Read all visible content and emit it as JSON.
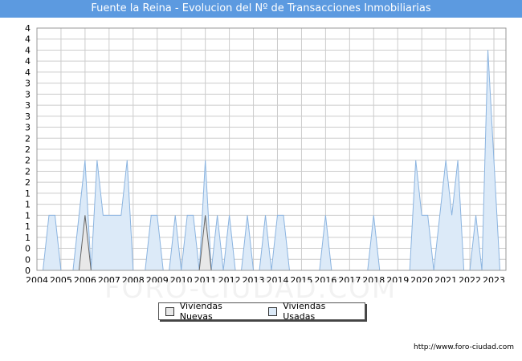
{
  "title": "Fuente la Reina - Evolucion del Nº de Transacciones Inmobiliarias",
  "watermark": "FORO-CIUDAD.COM",
  "footer": "http://www.foro-ciudad.com",
  "legend": {
    "nuevas": "Viviendas Nuevas",
    "usadas": "Viviendas Usadas"
  },
  "colors": {
    "title_bg": "#5c9ae0",
    "usadas_fill": "#dceaf8",
    "usadas_line": "#8bb4e0",
    "nuevas_fill": "#e8e8e8",
    "nuevas_line": "#666666",
    "grid": "#cccccc"
  },
  "chart_data": {
    "type": "area",
    "title": "Fuente la Reina - Evolucion del Nº de Transacciones Inmobiliarias",
    "xlabel": "",
    "ylabel": "",
    "x_ticks": [
      "2004",
      "2005",
      "2006",
      "2007",
      "2008",
      "2009",
      "2010",
      "2011",
      "2012",
      "2013",
      "2014",
      "2015",
      "2016",
      "2017",
      "2018",
      "2019",
      "2020",
      "2021",
      "2022",
      "2023"
    ],
    "y_ticks": [
      "0",
      "0",
      "0",
      "1",
      "1",
      "1",
      "1",
      "1",
      "2",
      "2",
      "2",
      "2",
      "2",
      "3",
      "3",
      "3",
      "3",
      "3",
      "4",
      "4",
      "4",
      "4",
      "4"
    ],
    "xlim": [
      2004,
      2023.5
    ],
    "ylim": [
      0,
      4.4
    ],
    "grid": true,
    "legend_position": "bottom",
    "x": [
      2004.25,
      2004.5,
      2004.75,
      2005,
      2005.25,
      2005.5,
      2005.75,
      2006,
      2006.25,
      2006.5,
      2006.75,
      2007,
      2007.25,
      2007.5,
      2007.75,
      2008,
      2008.25,
      2008.5,
      2008.75,
      2009,
      2009.25,
      2009.5,
      2009.75,
      2010,
      2010.25,
      2010.5,
      2010.75,
      2011,
      2011.25,
      2011.5,
      2011.75,
      2012,
      2012.25,
      2012.5,
      2012.75,
      2013,
      2013.25,
      2013.5,
      2013.75,
      2014,
      2014.25,
      2014.5,
      2014.75,
      2015,
      2015.25,
      2015.5,
      2015.75,
      2016,
      2016.25,
      2016.5,
      2016.75,
      2017,
      2017.25,
      2017.5,
      2017.75,
      2018,
      2018.25,
      2018.5,
      2018.75,
      2019,
      2019.25,
      2019.5,
      2019.75,
      2020,
      2020.25,
      2020.5,
      2020.75,
      2021,
      2021.25,
      2021.5,
      2021.75,
      2022,
      2022.25,
      2022.5,
      2022.75,
      2023,
      2023.25
    ],
    "series": [
      {
        "name": "Viviendas Nuevas",
        "values": [
          0,
          0,
          0,
          0,
          0,
          0,
          0,
          1,
          0,
          0,
          0,
          0,
          0,
          0,
          0,
          0,
          0,
          0,
          0,
          0,
          0,
          0,
          0,
          0,
          0,
          0,
          0,
          1,
          0,
          0,
          0,
          0,
          0,
          0,
          0,
          0,
          0,
          0,
          0,
          0,
          0,
          0,
          0,
          0,
          0,
          0,
          0,
          0,
          0,
          0,
          0,
          0,
          0,
          0,
          0,
          0,
          0,
          0,
          0,
          0,
          0,
          0,
          0,
          0,
          0,
          0,
          0,
          0,
          0,
          0,
          0,
          0,
          0,
          0,
          0,
          0,
          0
        ]
      },
      {
        "name": "Viviendas Usadas",
        "values": [
          0,
          1,
          1,
          0,
          0,
          0,
          1,
          2,
          0,
          2,
          1,
          1,
          1,
          1,
          2,
          0,
          0,
          0,
          1,
          1,
          0,
          0,
          1,
          0,
          1,
          1,
          0,
          2,
          0,
          1,
          0,
          1,
          0,
          0,
          1,
          0,
          0,
          1,
          0,
          1,
          1,
          0,
          0,
          0,
          0,
          0,
          0,
          1,
          0,
          0,
          0,
          0,
          0,
          0,
          0,
          1,
          0,
          0,
          0,
          0,
          0,
          0,
          2,
          1,
          1,
          0,
          1,
          2,
          1,
          2,
          0,
          0,
          1,
          0,
          4,
          2,
          0
        ]
      }
    ]
  }
}
